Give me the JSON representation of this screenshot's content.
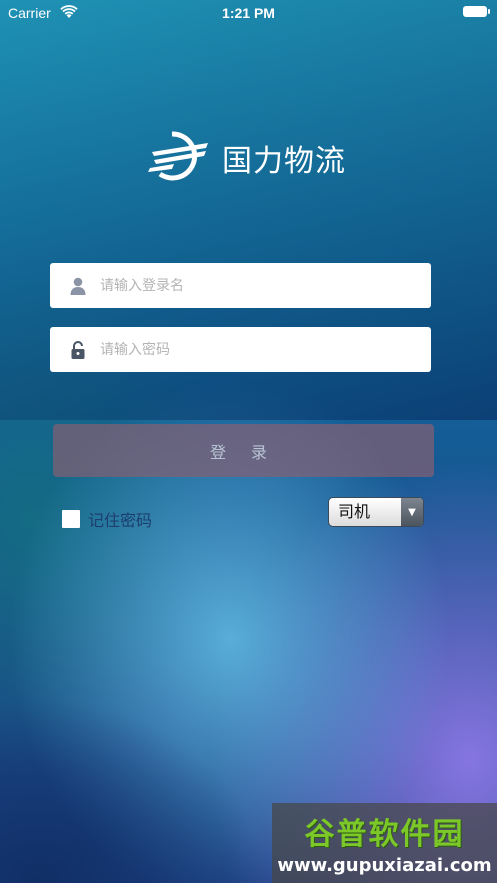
{
  "status_bar": {
    "carrier": "Carrier",
    "time": "1:21 PM"
  },
  "logo": {
    "name": "国力物流"
  },
  "login_form": {
    "username_placeholder": "请输入登录名",
    "password_placeholder": "请输入密码",
    "login_label": "登 录",
    "remember_label": "记住密码",
    "remember_checked": false,
    "role_value": "司机"
  },
  "watermark": {
    "title": "谷普软件园",
    "url": "www.gupuxiazai.com"
  },
  "icons": {
    "wifi": "wifi-icon",
    "battery": "battery-icon",
    "user": "user-icon",
    "lock": "lock-icon",
    "dropdown": "chevron-down-icon"
  },
  "colors": {
    "login_button": "#825f73",
    "watermark_green": "#7cc828",
    "remember_text": "#1c3f6e"
  }
}
